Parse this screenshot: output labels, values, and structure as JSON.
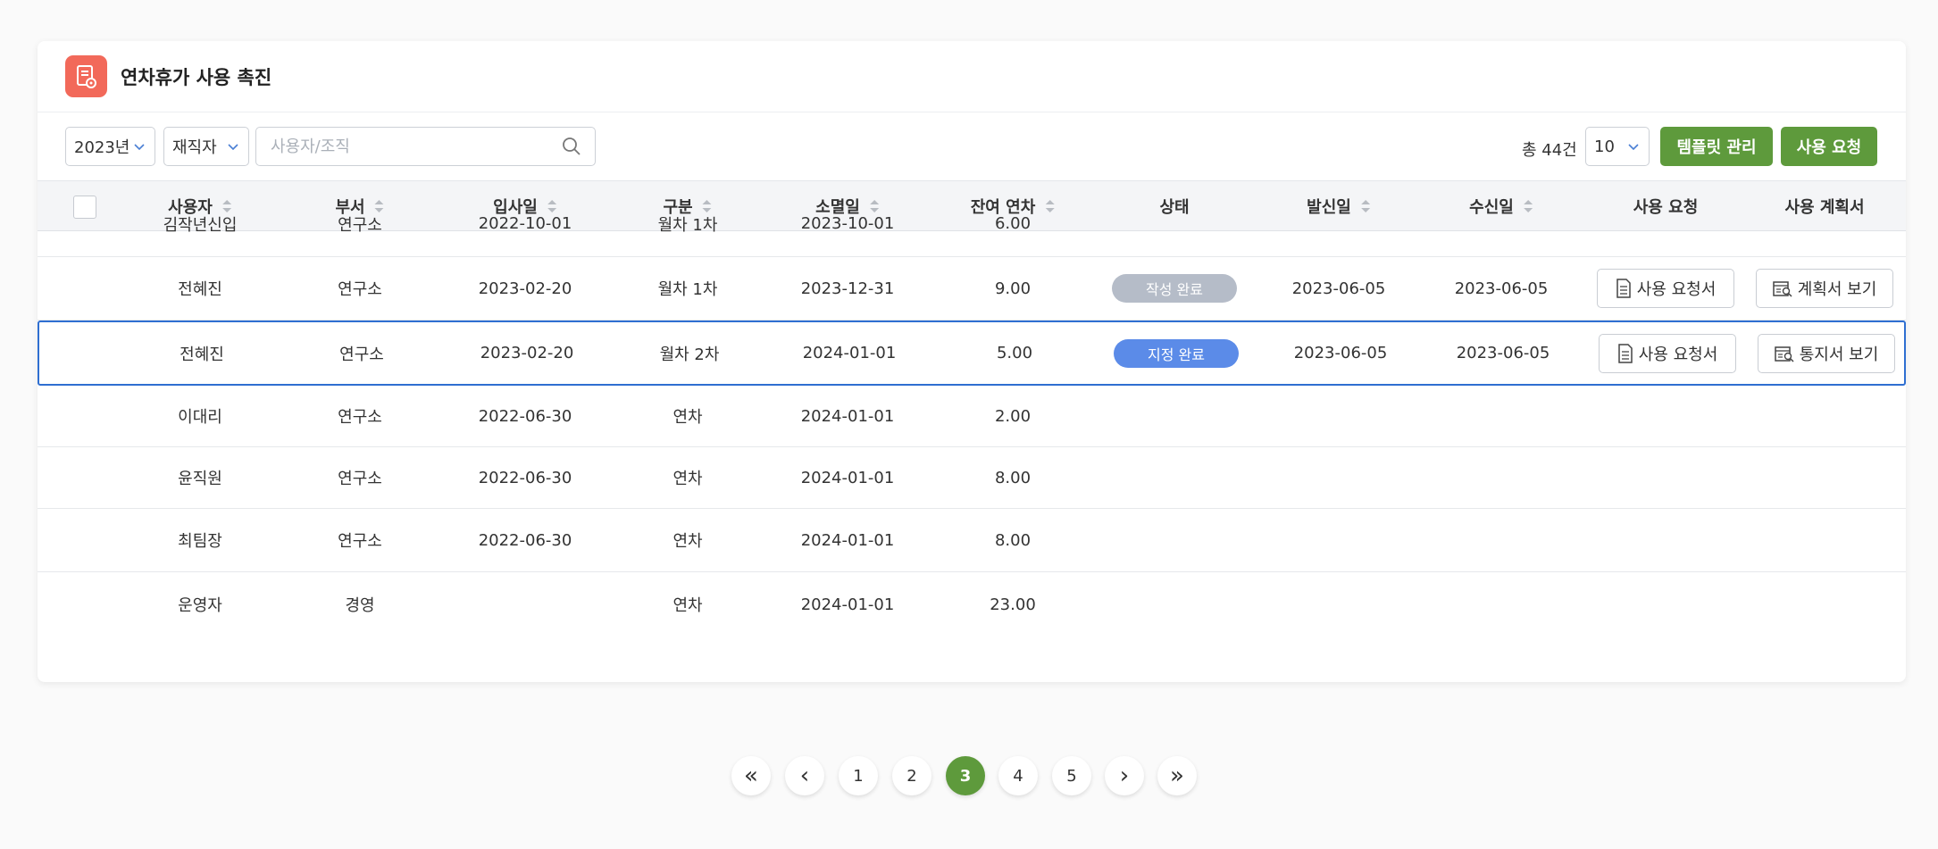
{
  "header": {
    "title": "연차휴가 사용 촉진",
    "icon": "document-settings-icon",
    "icon_color": "#f2695a"
  },
  "toolbar": {
    "year_select": "2023년",
    "status_select": "재직자",
    "search_placeholder": "사용자/조직",
    "total_label": "총 44건",
    "page_size": "10",
    "template_button": "템플릿 관리",
    "request_button": "사용 요청"
  },
  "colors": {
    "accent_green": "#5e9a3c",
    "badge_gray": "#b5bcc8",
    "badge_blue": "#5b8be8",
    "selected_border": "#2f6fd1"
  },
  "table": {
    "columns": [
      "사용자",
      "부서",
      "입사일",
      "구분",
      "소멸일",
      "잔여 연차",
      "상태",
      "발신일",
      "수신일",
      "사용 요청",
      "사용 계획서"
    ],
    "rows": [
      {
        "user": "김작년신입",
        "dept": "연구소",
        "hire": "2022-10-01",
        "type": "월차 1차",
        "expire": "2023-10-01",
        "remain": "6.00",
        "status": "",
        "sent": "",
        "received": "",
        "request": "",
        "plan": ""
      },
      {
        "user": "전혜진",
        "dept": "연구소",
        "hire": "2023-02-20",
        "type": "월차 1차",
        "expire": "2023-12-31",
        "remain": "9.00",
        "status": "작성 완료",
        "sent": "2023-06-05",
        "received": "2023-06-05",
        "request": "사용 요청서",
        "plan": "계획서 보기"
      },
      {
        "user": "전혜진",
        "dept": "연구소",
        "hire": "2023-02-20",
        "type": "월차 2차",
        "expire": "2024-01-01",
        "remain": "5.00",
        "status": "지정 완료",
        "sent": "2023-06-05",
        "received": "2023-06-05",
        "request": "사용 요청서",
        "plan": "통지서 보기"
      },
      {
        "user": "이대리",
        "dept": "연구소",
        "hire": "2022-06-30",
        "type": "연차",
        "expire": "2024-01-01",
        "remain": "2.00",
        "status": "",
        "sent": "",
        "received": "",
        "request": "",
        "plan": ""
      },
      {
        "user": "윤직원",
        "dept": "연구소",
        "hire": "2022-06-30",
        "type": "연차",
        "expire": "2024-01-01",
        "remain": "8.00",
        "status": "",
        "sent": "",
        "received": "",
        "request": "",
        "plan": ""
      },
      {
        "user": "최팀장",
        "dept": "연구소",
        "hire": "2022-06-30",
        "type": "연차",
        "expire": "2024-01-01",
        "remain": "8.00",
        "status": "",
        "sent": "",
        "received": "",
        "request": "",
        "plan": ""
      },
      {
        "user": "운영자",
        "dept": "경영",
        "hire": "",
        "type": "연차",
        "expire": "2024-01-01",
        "remain": "23.00",
        "status": "",
        "sent": "",
        "received": "",
        "request": "",
        "plan": ""
      }
    ]
  },
  "pagination": {
    "first": "«",
    "prev": "‹",
    "pages": [
      "1",
      "2",
      "3",
      "4",
      "5"
    ],
    "current": "3",
    "next": "›",
    "last": "»"
  }
}
